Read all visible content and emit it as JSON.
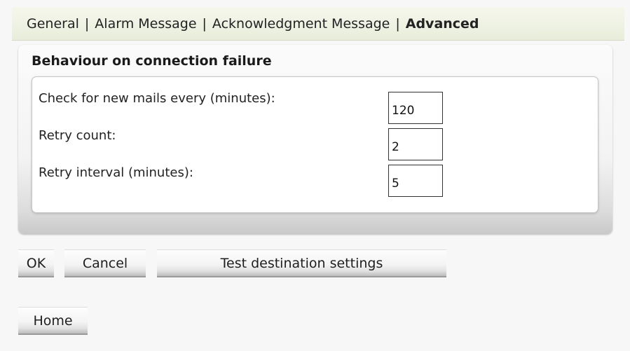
{
  "tabs": [
    {
      "label": "General",
      "active": false
    },
    {
      "label": "Alarm Message",
      "active": false
    },
    {
      "label": "Acknowledgment Message",
      "active": false
    },
    {
      "label": "Advanced",
      "active": true
    }
  ],
  "tab_separator": "|",
  "section": {
    "title": "Behaviour on connection failure",
    "fields": {
      "check_interval": {
        "label": "Check for new mails every (minutes):",
        "value": "120"
      },
      "retry_count": {
        "label": "Retry count:",
        "value": "2"
      },
      "retry_interval": {
        "label": "Retry interval (minutes):",
        "value": "5"
      }
    }
  },
  "buttons": {
    "ok": "OK",
    "cancel": "Cancel",
    "test": "Test destination settings",
    "home": "Home"
  }
}
